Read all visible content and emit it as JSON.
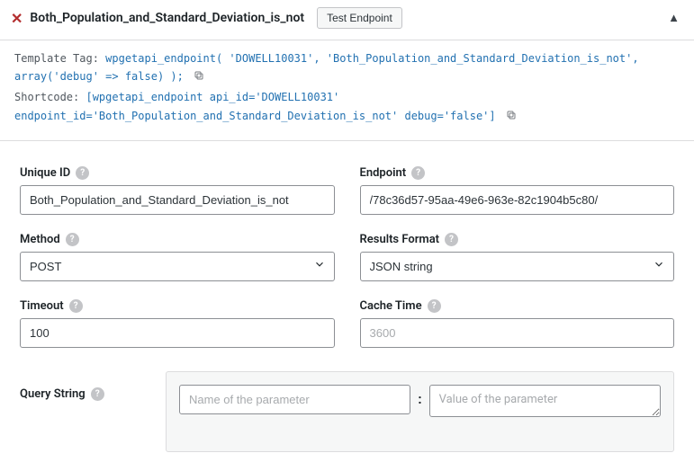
{
  "header": {
    "title": "Both_Population_and_Standard_Deviation_is_not",
    "test_button": "Test Endpoint"
  },
  "tags": {
    "template_label": "Template Tag: ",
    "template_code": "wpgetapi_endpoint( 'DOWELL10031', 'Both_Population_and_Standard_Deviation_is_not', array('debug' => false) );",
    "shortcode_label": "Shortcode: ",
    "shortcode_code": "[wpgetapi_endpoint api_id='DOWELL10031' endpoint_id='Both_Population_and_Standard_Deviation_is_not' debug='false']"
  },
  "form": {
    "unique_id": {
      "label": "Unique ID",
      "value": "Both_Population_and_Standard_Deviation_is_not"
    },
    "endpoint": {
      "label": "Endpoint",
      "value": "/78c36d57-95aa-49e6-963e-82c1904b5c80/"
    },
    "method": {
      "label": "Method",
      "value": "POST"
    },
    "results_format": {
      "label": "Results Format",
      "value": "JSON string"
    },
    "timeout": {
      "label": "Timeout",
      "value": "100"
    },
    "cache_time": {
      "label": "Cache Time",
      "placeholder": "3600"
    },
    "query_string": {
      "label": "Query String",
      "name_placeholder": "Name of the parameter",
      "value_placeholder": "Value of the parameter",
      "colon": ":"
    }
  }
}
